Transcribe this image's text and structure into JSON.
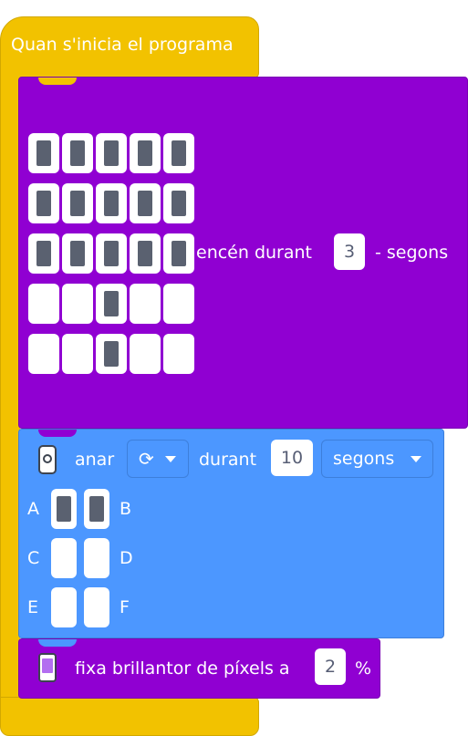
{
  "hat": {
    "label": "Quan s'inicia el programa"
  },
  "display_block": {
    "led_grid": [
      [
        1,
        1,
        1,
        1,
        1
      ],
      [
        1,
        1,
        1,
        1,
        1
      ],
      [
        1,
        1,
        1,
        1,
        1
      ],
      [
        0,
        0,
        1,
        0,
        0
      ],
      [
        0,
        0,
        1,
        0,
        0
      ]
    ],
    "label": "encén durant",
    "duration_value": "3",
    "unit": "- segons"
  },
  "motor_block": {
    "icon": "motor-pair-icon",
    "run_label": "anar",
    "direction_icon": "clockwise-icon",
    "during_label": "durant",
    "duration_value": "10",
    "unit_option": "segons",
    "ports": [
      {
        "left": "A",
        "right": "B",
        "left_on": true,
        "right_on": true
      },
      {
        "left": "C",
        "right": "D",
        "left_on": false,
        "right_on": false
      },
      {
        "left": "E",
        "right": "F",
        "left_on": false,
        "right_on": false
      }
    ]
  },
  "brightness_block": {
    "icon": "light-matrix-icon",
    "label": "fixa brillantor de píxels a",
    "value": "2",
    "unit": "%"
  },
  "colors": {
    "events_yellow": "#f2c200",
    "display_purple": "#9000d2",
    "motor_blue": "#4c97ff",
    "led_on": "#5a6170",
    "led_off": "#ffffff"
  }
}
